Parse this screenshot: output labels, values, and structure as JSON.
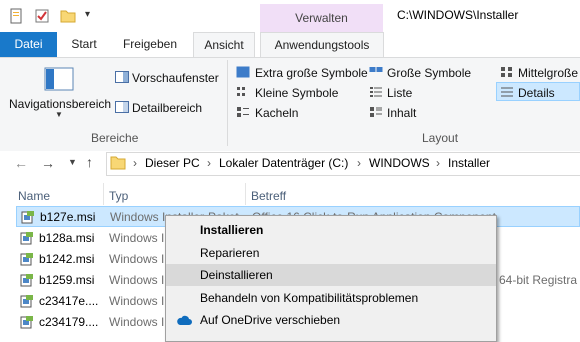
{
  "window": {
    "title": "C:\\WINDOWS\\Installer",
    "context_tab_group": "Verwalten"
  },
  "tabs": {
    "datei": "Datei",
    "start": "Start",
    "freigeben": "Freigeben",
    "ansicht": "Ansicht",
    "tools": "Anwendungstools"
  },
  "ribbon": {
    "navpane": "Navigationsbereich",
    "preview": "Vorschaufenster",
    "details_pane": "Detailbereich",
    "group_panes": "Bereiche",
    "layout": {
      "xl_icons": "Extra große Symbole",
      "large_icons": "Große Symbole",
      "medium_icons": "Mittelgroße",
      "small_icons": "Kleine Symbole",
      "list": "Liste",
      "details": "Details",
      "tiles": "Kacheln",
      "content": "Inhalt",
      "group": "Layout"
    }
  },
  "breadcrumb": [
    "Dieser PC",
    "Lokaler Datenträger (C:)",
    "WINDOWS",
    "Installer"
  ],
  "columns": {
    "name": "Name",
    "type": "Typ",
    "subject": "Betreff"
  },
  "files": [
    {
      "name": "b127e.msi",
      "type": "Windows Installer-Paket",
      "subject": "Office 16 Click-to-Run Application Component"
    },
    {
      "name": "b128a.msi",
      "type": "Windows I",
      "subject": ""
    },
    {
      "name": "b1242.msi",
      "type": "Windows I",
      "subject": ""
    },
    {
      "name": "b1259.msi",
      "type": "Windows I",
      "subject": "64-bit Registra"
    },
    {
      "name": "c23417e....",
      "type": "Windows I",
      "subject": ""
    },
    {
      "name": "c234179....",
      "type": "Windows I",
      "subject": ""
    }
  ],
  "context_menu": {
    "install": "Installieren",
    "repair": "Reparieren",
    "uninstall": "Deinstallieren",
    "compat": "Behandeln von Kompatibilitätsproblemen",
    "onedrive": "Auf OneDrive verschieben"
  },
  "colors": {
    "accent": "#1979ca",
    "selection": "#cce8ff",
    "context_group": "#f1dff7"
  }
}
